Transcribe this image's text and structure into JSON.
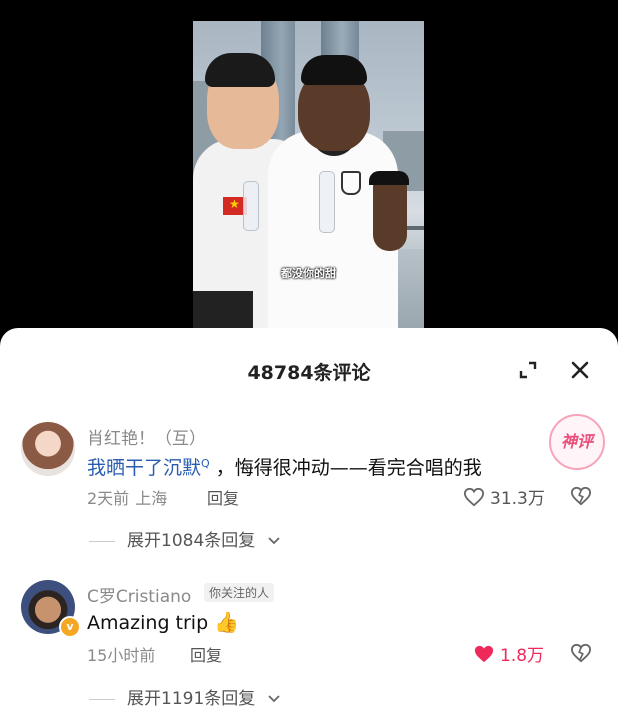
{
  "video": {
    "subtitle": "都没你的甜"
  },
  "comments_panel": {
    "title": "48784条评论"
  },
  "comments": [
    {
      "username": "肖红艳！（互）",
      "text_link": "我晒干了沉默",
      "text_rest": "，悔得很冲动——看完合唱的我",
      "time": "2天前",
      "location": "上海",
      "reply_label": "回复",
      "likes": "31.3万",
      "badge": "神评",
      "expand_label": "展开1084条回复"
    },
    {
      "username": "C罗Cristiano",
      "follow_tag": "你关注的人",
      "text": "Amazing trip",
      "emoji": "👍",
      "time": "15小时前",
      "reply_label": "回复",
      "likes": "1.8万",
      "liked": true,
      "verified_badge": "v",
      "expand_label": "展开1191条回复"
    }
  ],
  "colors": {
    "like_active": "#f0295b",
    "link": "#2a5db0",
    "muted_text": "#8a8a8a"
  }
}
